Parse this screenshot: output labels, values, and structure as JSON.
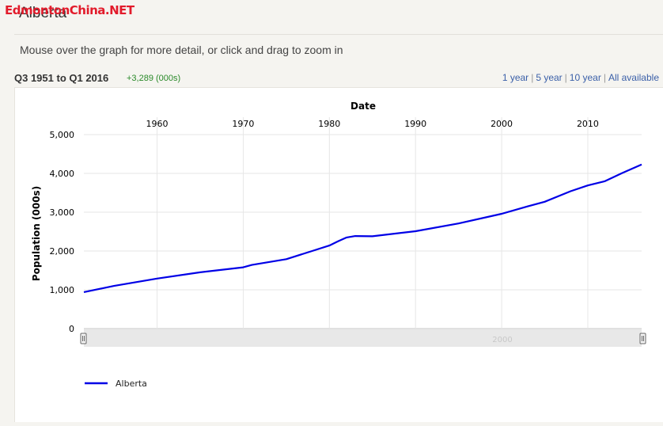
{
  "watermark": "EdmontonChina.NET",
  "page_title": "Alberta",
  "instructions": "Mouse over the graph for more detail, or click and drag to zoom in",
  "range": {
    "label": "Q3 1951 to Q1 2016",
    "change": "+3,289 (000s)"
  },
  "period_links": [
    "1 year",
    "5 year",
    "10 year",
    "All available"
  ],
  "navigator_label": "2000",
  "colors": {
    "series": "#0000e6",
    "link": "#3a5fa8",
    "change": "#2a8a2a",
    "navigator": "#e8e8e8",
    "watermark": "#e21b2b"
  },
  "chart_data": {
    "type": "line",
    "title": "",
    "xlabel": "Date",
    "ylabel": "Population (000s)",
    "x_ticks": [
      1960,
      1970,
      1980,
      1990,
      2000,
      2010
    ],
    "y_ticks": [
      "0",
      "1,000",
      "2,000",
      "3,000",
      "4,000",
      "5,000"
    ],
    "xlim": [
      1951.5,
      2016.25
    ],
    "ylim": [
      0,
      5000
    ],
    "grid": true,
    "legend_position": "bottom-left",
    "series": [
      {
        "name": "Alberta",
        "color": "#0000e6",
        "x": [
          1951.5,
          1955,
          1960,
          1965,
          1970,
          1971,
          1975,
          1978,
          1980,
          1981,
          1982,
          1983,
          1985,
          1990,
          1995,
          2000,
          2003,
          2005,
          2008,
          2010,
          2012,
          2014,
          2016.25
        ],
        "y": [
          940,
          1100,
          1290,
          1450,
          1580,
          1640,
          1790,
          2000,
          2140,
          2250,
          2350,
          2385,
          2380,
          2510,
          2710,
          2960,
          3150,
          3270,
          3540,
          3690,
          3800,
          4010,
          4230
        ]
      }
    ]
  }
}
